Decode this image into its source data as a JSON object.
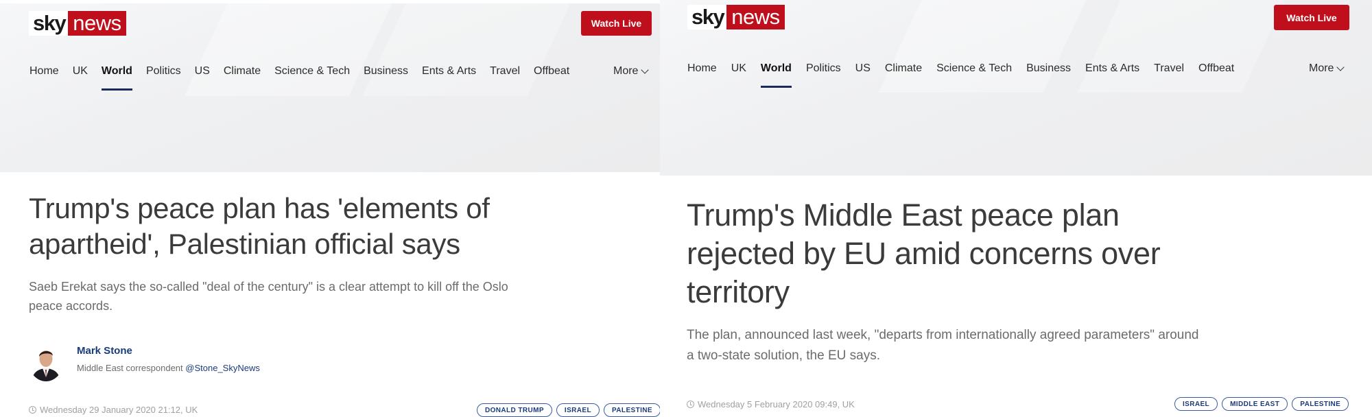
{
  "left": {
    "logo": {
      "sky": "sky",
      "news": "news"
    },
    "watch_live": "Watch Live",
    "nav": [
      "Home",
      "UK",
      "World",
      "Politics",
      "US",
      "Climate",
      "Science & Tech",
      "Business",
      "Ents & Arts",
      "Travel",
      "Offbeat"
    ],
    "active_nav": "World",
    "more": "More",
    "headline": "Trump's peace plan has 'elements of apartheid', Palestinian official says",
    "standfirst": "Saeb Erekat says the so-called \"deal of the century\" is a clear attempt to kill off the Oslo peace accords.",
    "author": {
      "name": "Mark Stone",
      "role": "Middle East correspondent",
      "handle": "@Stone_SkyNews"
    },
    "timestamp": "Wednesday 29 January 2020 21:12, UK",
    "tags": [
      "DONALD TRUMP",
      "ISRAEL",
      "PALESTINE"
    ]
  },
  "right": {
    "logo": {
      "sky": "sky",
      "news": "news"
    },
    "watch_live": "Watch Live",
    "nav": [
      "Home",
      "UK",
      "World",
      "Politics",
      "US",
      "Climate",
      "Science & Tech",
      "Business",
      "Ents & Arts",
      "Travel",
      "Offbeat"
    ],
    "active_nav": "World",
    "more": "More",
    "headline": "Trump's Middle East peace plan rejected by EU amid concerns over territory",
    "standfirst": "The plan, announced last week, \"departs from internationally agreed parameters\" around a two-state solution, the EU says.",
    "timestamp": "Wednesday 5 February 2020 09:49, UK",
    "tags": [
      "ISRAEL",
      "MIDDLE EAST",
      "PALESTINE"
    ]
  },
  "colors": {
    "brand_red": "#c00f1c",
    "link_blue": "#1a3a7a",
    "active_underline": "#1a2a5a"
  }
}
